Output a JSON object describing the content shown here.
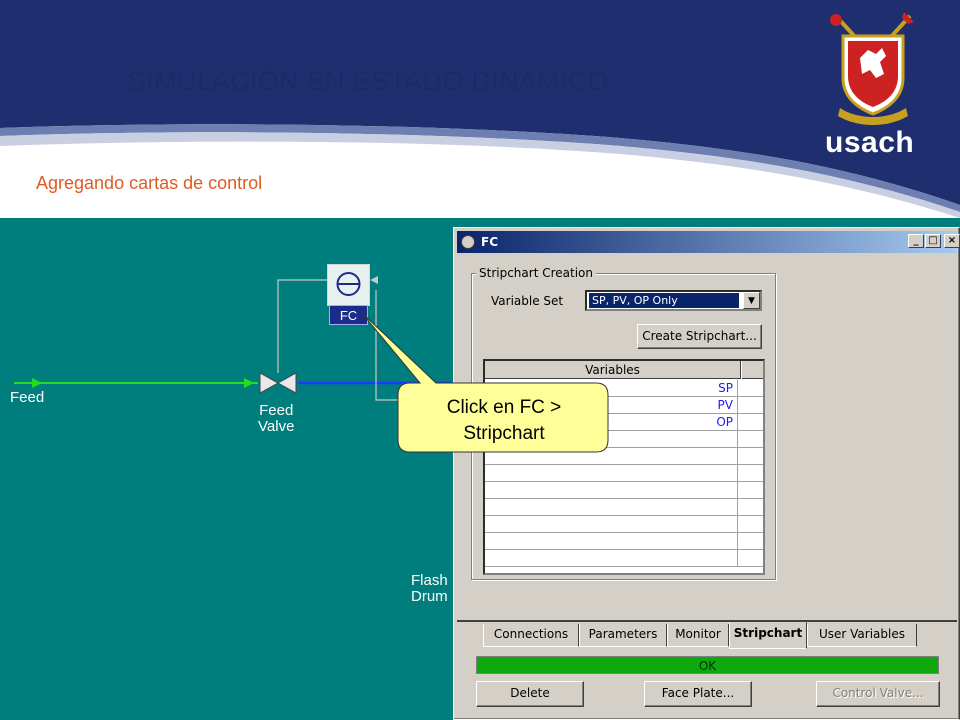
{
  "slide": {
    "title": "SIMULACIÓN EN ESTADO DINÁMICO",
    "subtitle": "Agregando cartas de control",
    "logo_text": "usach"
  },
  "pfd": {
    "stream_feed": "Feed",
    "valve_label_line1": "Feed",
    "valve_label_line2": "Valve",
    "controller_tag": "FC",
    "vessel_label_line1": "Flash",
    "vessel_label_line2": "Drum"
  },
  "window": {
    "title": "FC",
    "groupbox_label": "Stripchart Creation",
    "variable_set_label": "Variable Set",
    "variable_set_value": "SP, PV, OP Only",
    "create_button": "Create Stripchart...",
    "table_header": "Variables",
    "variables": [
      "SP",
      "PV",
      "OP",
      "",
      "",
      "",
      "",
      "",
      "",
      "",
      ""
    ],
    "tabs": [
      {
        "label": "Connections",
        "active": false
      },
      {
        "label": "Parameters",
        "active": false
      },
      {
        "label": "Monitor",
        "active": false
      },
      {
        "label": "Stripchart",
        "active": true
      },
      {
        "label": "User Variables",
        "active": false
      }
    ],
    "status": "OK",
    "delete_button": "Delete",
    "faceplate_button": "Face Plate...",
    "controlvalve_button": "Control Valve..."
  },
  "callout": {
    "line1": "Click en FC >",
    "line2": "Stripchart"
  },
  "colors": {
    "header_navy": "#1e2a66",
    "subtitle_orange": "#e05a22",
    "canvas_teal": "#007d7d",
    "feed_stream_green": "#22dd22",
    "product_stream_blue": "#1a3cff",
    "status_green": "#0fa80f",
    "callout_fill": "#ffff99"
  }
}
